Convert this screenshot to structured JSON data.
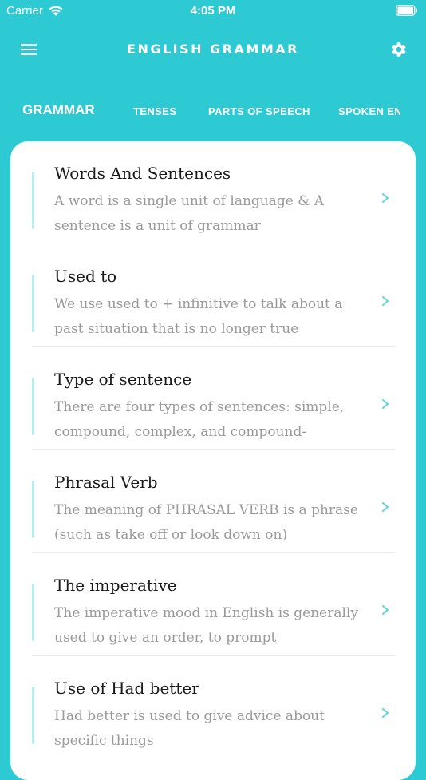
{
  "status": {
    "carrier": "Carrier",
    "time": "4:05 PM"
  },
  "nav": {
    "title": "ENGLISH GRAMMAR",
    "menu_icon": "hamburger-menu-icon",
    "settings_icon": "gear-icon"
  },
  "tabs": [
    {
      "label": "GRAMMAR",
      "active": true
    },
    {
      "label": "TENSES",
      "active": false
    },
    {
      "label": "PARTS OF SPEECH",
      "active": false
    },
    {
      "label": "SPOKEN ENGLISH",
      "active": false
    }
  ],
  "items": [
    {
      "title": "Words And Sentences",
      "description": "A word is a single unit of language & A sentence is a unit of grammar"
    },
    {
      "title": "Used to",
      "description": "We use used to + infinitive to talk about a past situation that is no longer true"
    },
    {
      "title": "Type of sentence",
      "description": "There are four types of sentences: simple, compound, complex, and compound-"
    },
    {
      "title": "Phrasal Verb",
      "description": "The meaning of PHRASAL VERB is a phrase (such as take off or look down on)"
    },
    {
      "title": "The imperative",
      "description": "The imperative mood in English is generally used to give an order, to prompt"
    },
    {
      "title": "Use of Had better",
      "description": "Had better is used to give advice about specific things"
    }
  ],
  "colors": {
    "accent": "#2ECAD3",
    "chevron": "#5FD5DC",
    "bar": "#B5EEF1"
  }
}
